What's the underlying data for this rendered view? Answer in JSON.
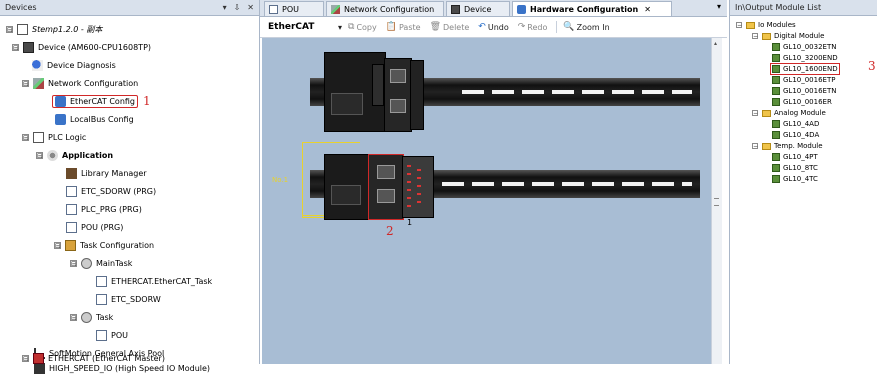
{
  "left_panel": {
    "title": "Devices",
    "controls": [
      "▾",
      "⇩",
      "✕"
    ],
    "tree": [
      {
        "label": "Stemp1.2.0 - 副本",
        "icon": "project-icon",
        "toggle": "⊟",
        "italic": true
      },
      {
        "label": "Device (AM600-CPU1608TP)",
        "icon": "device-icon",
        "toggle": "⊟"
      },
      {
        "label": "Device Diagnosis",
        "icon": "diagnosis-icon",
        "toggle": ""
      },
      {
        "label": "Network Configuration",
        "icon": "network-icon",
        "toggle": "⊟"
      },
      {
        "label": "EtherCAT Config",
        "icon": "ethercat-icon",
        "toggle": "",
        "marker": "1"
      },
      {
        "label": "LocalBus Config",
        "icon": "ethercat-icon",
        "toggle": ""
      },
      {
        "label": "PLC Logic",
        "icon": "plc-icon",
        "toggle": "⊟"
      },
      {
        "label": "Application",
        "icon": "application-icon",
        "toggle": "⊟",
        "bold": true
      },
      {
        "label": "Library Manager",
        "icon": "library-icon",
        "toggle": ""
      },
      {
        "label": "ETC_SDORW (PRG)",
        "icon": "program-icon",
        "toggle": ""
      },
      {
        "label": "PLC_PRG (PRG)",
        "icon": "program-icon",
        "toggle": ""
      },
      {
        "label": "POU (PRG)",
        "icon": "program-icon",
        "toggle": ""
      },
      {
        "label": "Task Configuration",
        "icon": "task-config-icon",
        "toggle": "⊟"
      },
      {
        "label": "MainTask",
        "icon": "task-icon",
        "toggle": "⊟"
      },
      {
        "label": "ETHERCAT.EtherCAT_Task",
        "icon": "call-icon",
        "toggle": ""
      },
      {
        "label": "ETC_SDORW",
        "icon": "call-icon",
        "toggle": ""
      },
      {
        "label": "Task",
        "icon": "task-icon",
        "toggle": "⊟"
      },
      {
        "label": "POU",
        "icon": "call-icon",
        "toggle": ""
      },
      {
        "label": "SoftMotion General Axis Pool",
        "icon": "axis-icon",
        "toggle": ""
      },
      {
        "label": "HIGH_SPEED_IO (High Speed IO Module)",
        "icon": "io-icon",
        "toggle": ""
      },
      {
        "label": "ETHERCAT (EtherCAT Master)",
        "icon": "ethercat-master-icon",
        "toggle": "⊟"
      }
    ]
  },
  "center": {
    "tabs": [
      {
        "label": "POU",
        "active": false
      },
      {
        "label": "Network Configuration",
        "active": false
      },
      {
        "label": "Device",
        "active": false
      },
      {
        "label": "Hardware Configuration",
        "active": true,
        "close": "✕"
      }
    ],
    "tabs_dropdown": "▾",
    "toolbar": {
      "title": "EtherCAT",
      "dropdown": "▾",
      "copy": "Copy",
      "paste": "Paste",
      "delete": "Delete",
      "undo": "Undo",
      "redo": "Redo",
      "zoom_in": "Zoom In"
    },
    "canvas": {
      "rail_marker": "No.1",
      "slot_number": "1",
      "marker_2": "2"
    }
  },
  "right_panel": {
    "title": "In\\Output Module List",
    "root": "Io Modules",
    "groups": [
      {
        "label": "Digital Module",
        "items": [
          "GL10_0032ETN",
          "GL10_3200END",
          "GL10_1600END",
          "GL10_0016ETP",
          "GL10_0016ETN",
          "GL10_0016ER"
        ],
        "highlight_index": 2,
        "marker": "3"
      },
      {
        "label": "Analog Module",
        "items": [
          "GL10_4AD",
          "GL10_4DA"
        ]
      },
      {
        "label": "Temp. Module",
        "items": [
          "GL10_4PT",
          "GL10_8TC",
          "GL10_4TC"
        ]
      }
    ]
  },
  "colors": {
    "canvas_bg": "#a8bdd4",
    "highlight_red": "#d02828",
    "bracket_yellow": "#e8d22e",
    "panel_header": "#d9e1ec"
  }
}
